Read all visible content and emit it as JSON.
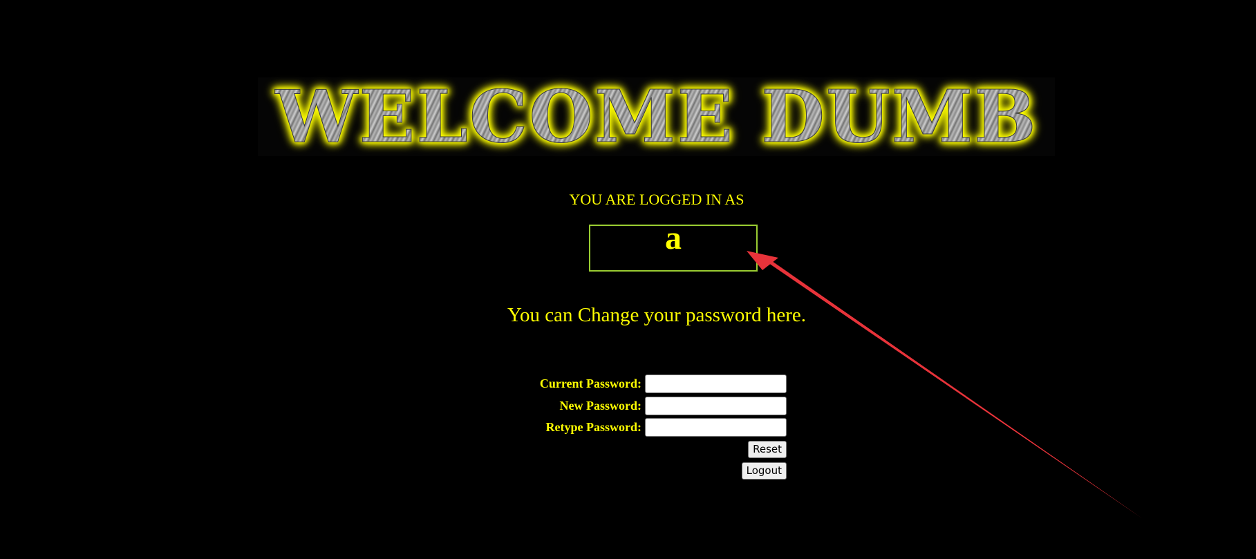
{
  "banner": {
    "text": "WELCOME DUMB"
  },
  "session": {
    "logged_in_label": "YOU ARE LOGGED IN AS",
    "username": "a"
  },
  "change_password": {
    "heading": "You can Change your password here.",
    "fields": [
      {
        "label": "Current Password:",
        "value": ""
      },
      {
        "label": "New Password:",
        "value": ""
      },
      {
        "label": "Retype Password:",
        "value": ""
      }
    ],
    "reset_label": "Reset",
    "logout_label": "Logout"
  },
  "colors": {
    "background": "#000000",
    "text": "#ffff00",
    "box_border": "#9acd32",
    "annotation_arrow": "#e8333a"
  }
}
